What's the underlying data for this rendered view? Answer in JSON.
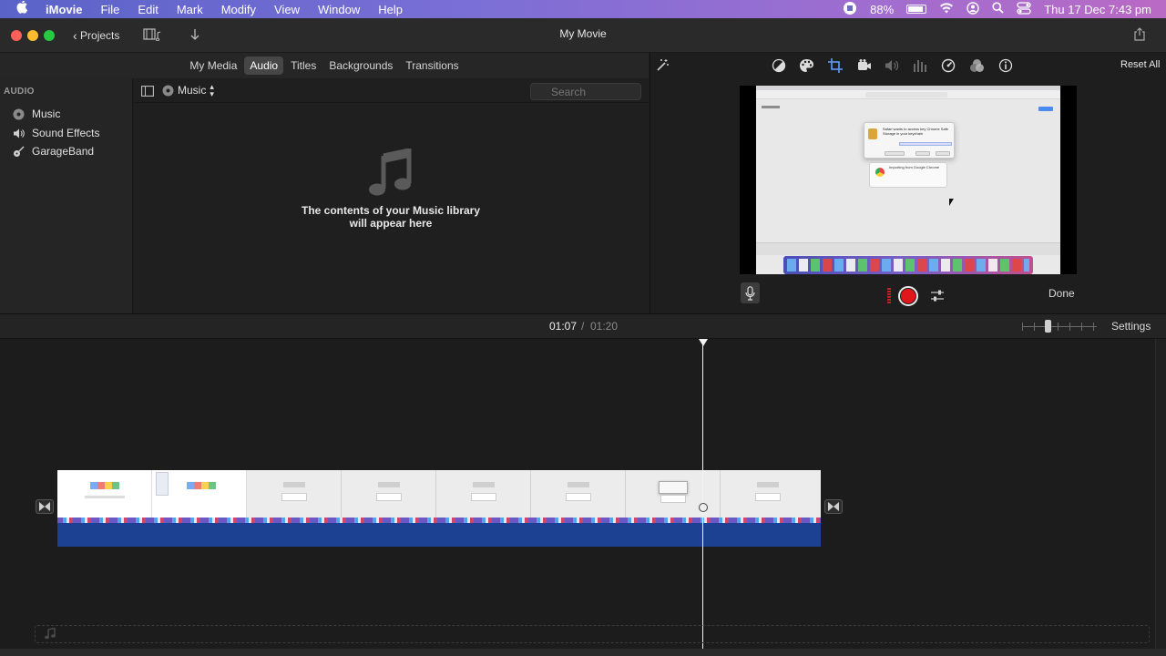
{
  "menubar": {
    "app_name": "iMovie",
    "items": [
      "File",
      "Edit",
      "Mark",
      "Modify",
      "View",
      "Window",
      "Help"
    ],
    "battery": "88%",
    "battery_level": 0.88,
    "clock": "Thu 17 Dec  7:43 pm"
  },
  "window": {
    "title": "My Movie",
    "projects_label": "Projects"
  },
  "browser_tabs": [
    {
      "label": "My Media",
      "active": false
    },
    {
      "label": "Audio",
      "active": true
    },
    {
      "label": "Titles",
      "active": false
    },
    {
      "label": "Backgrounds",
      "active": false
    },
    {
      "label": "Transitions",
      "active": false
    }
  ],
  "sidebar": {
    "heading": "AUDIO",
    "items": [
      "Music",
      "Sound Effects",
      "GarageBand"
    ]
  },
  "browser": {
    "source_label": "Music",
    "search_placeholder": "Search",
    "empty_message": "The contents of your Music library will appear here"
  },
  "viewer": {
    "reset_all": "Reset All",
    "done": "Done"
  },
  "timebar": {
    "current_time": "01:07",
    "separator": "/",
    "total_time": "01:20",
    "settings_label": "Settings"
  },
  "preview_screen": {
    "dialog_line": "Safari wants to access key Chrome Safe Storage in your keychain",
    "import_label": "Importing from Google Chrome"
  },
  "colors": {
    "record_red": "#e0161b",
    "clip_blue": "#1c4192",
    "accent": "#6e82d8"
  },
  "icons": {
    "apple": "apple-icon",
    "wifi": "wifi-icon",
    "search": "search-icon",
    "music_note": "music-note-icon",
    "microphone": "microphone-icon"
  }
}
